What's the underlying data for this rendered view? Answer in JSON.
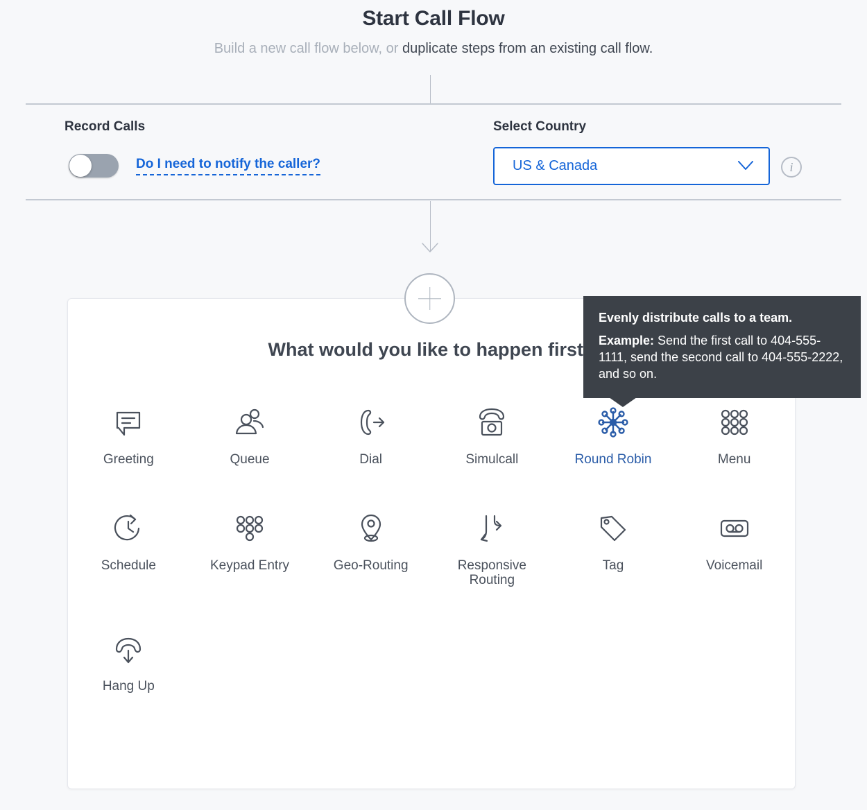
{
  "header": {
    "title": "Start Call Flow",
    "subtitle_muted": "Build a new call flow below, or ",
    "subtitle_link": "duplicate steps from an existing call flow."
  },
  "settings": {
    "record_calls_label": "Record Calls",
    "record_calls_toggle_state": "off",
    "notify_link": "Do I need to notify the caller?",
    "select_country_label": "Select Country",
    "selected_country": "US & Canada",
    "info_glyph": "i"
  },
  "add_step": {
    "plus_label": "+"
  },
  "card": {
    "heading": "What would you like to happen first?",
    "options": [
      {
        "label": "Greeting",
        "icon": "speech-bubble-icon",
        "selected": false
      },
      {
        "label": "Queue",
        "icon": "people-icon",
        "selected": false
      },
      {
        "label": "Dial",
        "icon": "phone-outgoing-icon",
        "selected": false
      },
      {
        "label": "Simulcall",
        "icon": "phone-camera-icon",
        "selected": false
      },
      {
        "label": "Round Robin",
        "icon": "round-robin-icon",
        "selected": true
      },
      {
        "label": "Menu",
        "icon": "grid-nine-dots-icon",
        "selected": false
      },
      {
        "label": "Schedule",
        "icon": "clock-refresh-icon",
        "selected": false
      },
      {
        "label": "Keypad Entry",
        "icon": "keypad-dots-icon",
        "selected": false
      },
      {
        "label": "Geo-Routing",
        "icon": "map-pin-icon",
        "selected": false
      },
      {
        "label": "Responsive\nRouting",
        "icon": "branch-arrows-icon",
        "selected": false
      },
      {
        "label": "Tag",
        "icon": "tag-icon",
        "selected": false
      },
      {
        "label": "Voicemail",
        "icon": "voicemail-icon",
        "selected": false
      },
      {
        "label": "Hang Up",
        "icon": "phone-hangup-icon",
        "selected": false
      }
    ]
  },
  "tooltip": {
    "title": "Evenly distribute calls to a team.",
    "example_label": "Example:",
    "example_text": " Send the first call to 404-555-1111, send the second call to 404-555-2222, and so on."
  },
  "colors": {
    "page_bg": "#f7f8fa",
    "accent_blue": "#1565d8",
    "selected_blue": "#2a5ca8",
    "icon_gray": "#4a515c",
    "tooltip_bg": "#3c4148"
  }
}
